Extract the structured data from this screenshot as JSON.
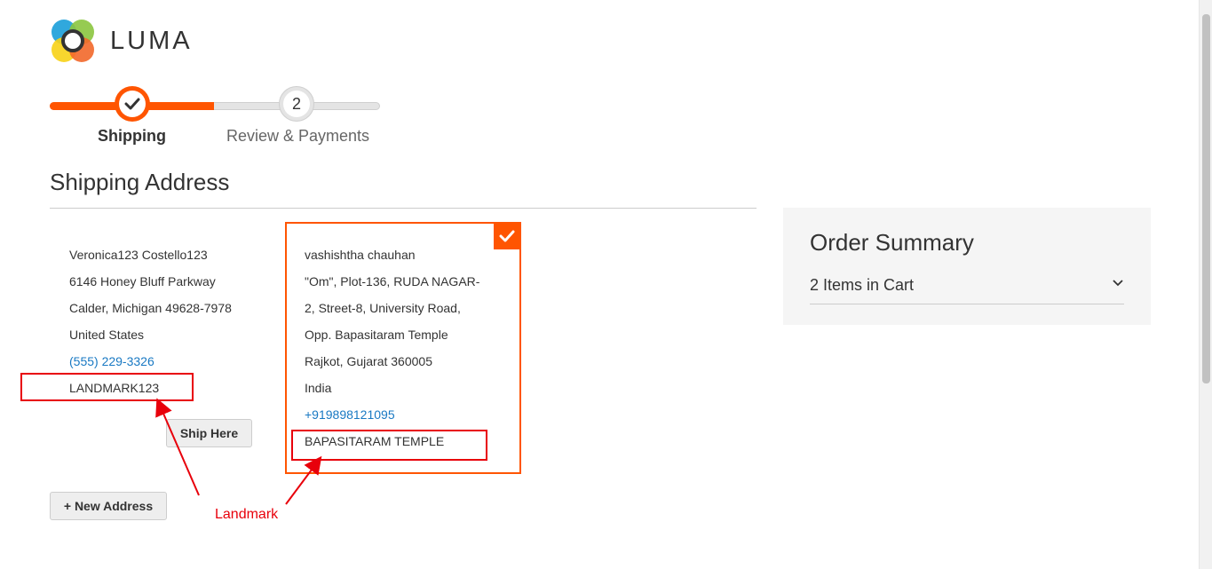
{
  "brand": {
    "name": "LUMA"
  },
  "colors": {
    "accent": "#ff5501",
    "link": "#1979c3",
    "annotation": "#e8000b",
    "summary_bg": "#f5f5f5"
  },
  "progress": {
    "steps": [
      {
        "number": "1",
        "label": "Shipping",
        "state": "complete"
      },
      {
        "number": "2",
        "label": "Review & Payments",
        "state": "pending"
      }
    ]
  },
  "shipping": {
    "title": "Shipping Address",
    "addresses": [
      {
        "lines": [
          "Veronica123 Costello123",
          "6146 Honey Bluff Parkway",
          "Calder, Michigan 49628-7978",
          "United States"
        ],
        "phone": "(555) 229-3326",
        "landmark": "LANDMARK123",
        "selected": false,
        "action_label": "Ship Here"
      },
      {
        "lines": [
          "vashishtha chauhan",
          "\"Om\", Plot-136, RUDA NAGAR-",
          "2, Street-8, University Road,",
          "Opp. Bapasitaram Temple",
          "Rajkot, Gujarat 360005",
          "India"
        ],
        "phone": "+919898121095",
        "landmark": "BAPASITARAM TEMPLE",
        "selected": true
      }
    ],
    "new_address_label": "+ New Address"
  },
  "annotation": {
    "label": "Landmark"
  },
  "summary": {
    "title": "Order Summary",
    "items_label": "2 Items in Cart",
    "icon": "chevron-down-icon"
  }
}
